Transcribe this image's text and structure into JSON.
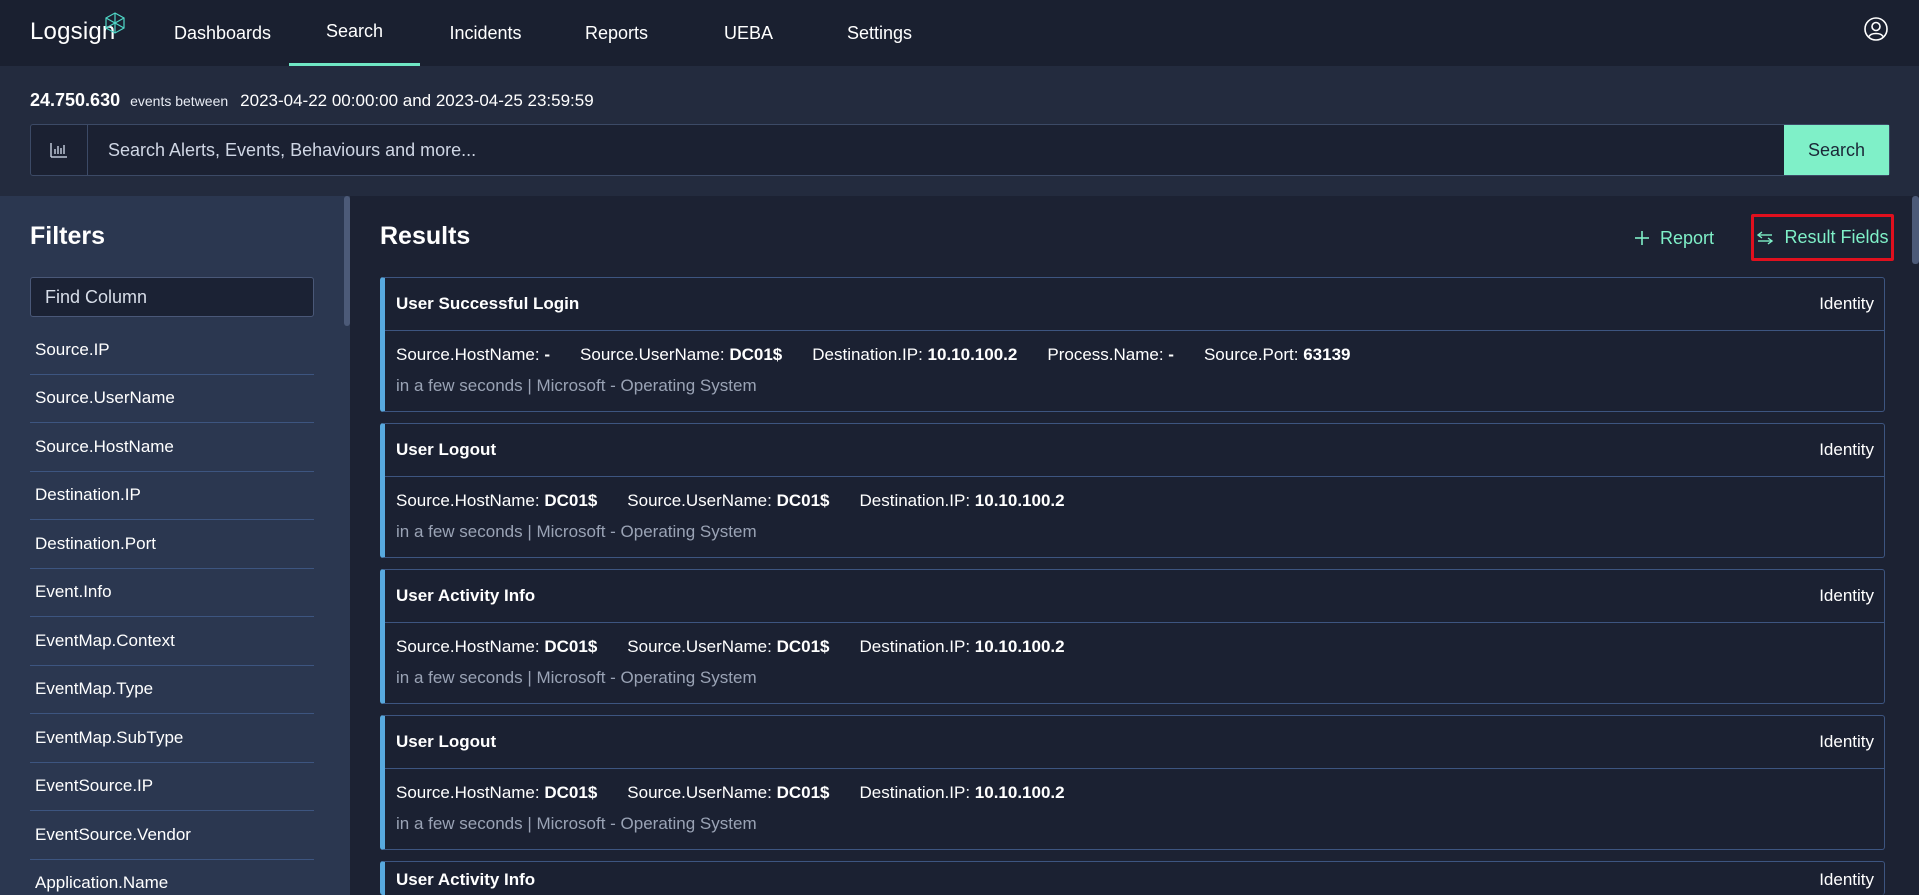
{
  "app": {
    "logo_text": "Logsign"
  },
  "nav": {
    "items": [
      {
        "label": "Dashboards"
      },
      {
        "label": "Search"
      },
      {
        "label": "Incidents"
      },
      {
        "label": "Reports"
      },
      {
        "label": "UEBA"
      },
      {
        "label": "Settings"
      }
    ],
    "active": "Search"
  },
  "header": {
    "event_count": "24.750.630",
    "events_between_label": "events between",
    "date_range": "2023-04-22 00:00:00 and 2023-04-25 23:59:59"
  },
  "search": {
    "placeholder": "Search Alerts, Events, Behaviours and more...",
    "button_label": "Search"
  },
  "filters": {
    "title": "Filters",
    "find_placeholder": "Find Column",
    "items": [
      {
        "label": "Source.IP"
      },
      {
        "label": "Source.UserName"
      },
      {
        "label": "Source.HostName"
      },
      {
        "label": "Destination.IP"
      },
      {
        "label": "Destination.Port"
      },
      {
        "label": "Event.Info"
      },
      {
        "label": "EventMap.Context"
      },
      {
        "label": "EventMap.Type"
      },
      {
        "label": "EventMap.SubType"
      },
      {
        "label": "EventSource.IP"
      },
      {
        "label": "EventSource.Vendor"
      },
      {
        "label": "Application.Name"
      }
    ]
  },
  "results": {
    "title": "Results",
    "report_label": "Report",
    "result_fields_label": "Result Fields",
    "cards": [
      {
        "title": "User Successful Login",
        "category": "Identity",
        "fields": [
          {
            "key": "Source.HostName:",
            "value": "-"
          },
          {
            "key": "Source.UserName:",
            "value": "DC01$"
          },
          {
            "key": "Destination.IP:",
            "value": "10.10.100.2"
          },
          {
            "key": "Process.Name:",
            "value": "-"
          },
          {
            "key": "Source.Port:",
            "value": "63139"
          }
        ],
        "meta": "in a few seconds | Microsoft - Operating System"
      },
      {
        "title": "User Logout",
        "category": "Identity",
        "fields": [
          {
            "key": "Source.HostName:",
            "value": "DC01$"
          },
          {
            "key": "Source.UserName:",
            "value": "DC01$"
          },
          {
            "key": "Destination.IP:",
            "value": "10.10.100.2"
          }
        ],
        "meta": "in a few seconds | Microsoft - Operating System"
      },
      {
        "title": "User Activity Info",
        "category": "Identity",
        "fields": [
          {
            "key": "Source.HostName:",
            "value": "DC01$"
          },
          {
            "key": "Source.UserName:",
            "value": "DC01$"
          },
          {
            "key": "Destination.IP:",
            "value": "10.10.100.2"
          }
        ],
        "meta": "in a few seconds | Microsoft - Operating System"
      },
      {
        "title": "User Logout",
        "category": "Identity",
        "fields": [
          {
            "key": "Source.HostName:",
            "value": "DC01$"
          },
          {
            "key": "Source.UserName:",
            "value": "DC01$"
          },
          {
            "key": "Destination.IP:",
            "value": "10.10.100.2"
          }
        ],
        "meta": "in a few seconds | Microsoft - Operating System"
      },
      {
        "title": "User Activity Info",
        "category": "Identity",
        "fields": [],
        "meta": ""
      }
    ]
  },
  "colors": {
    "accent": "#7ff0c8",
    "card_border_left": "#58a9de",
    "highlight_box": "#e0101e"
  }
}
